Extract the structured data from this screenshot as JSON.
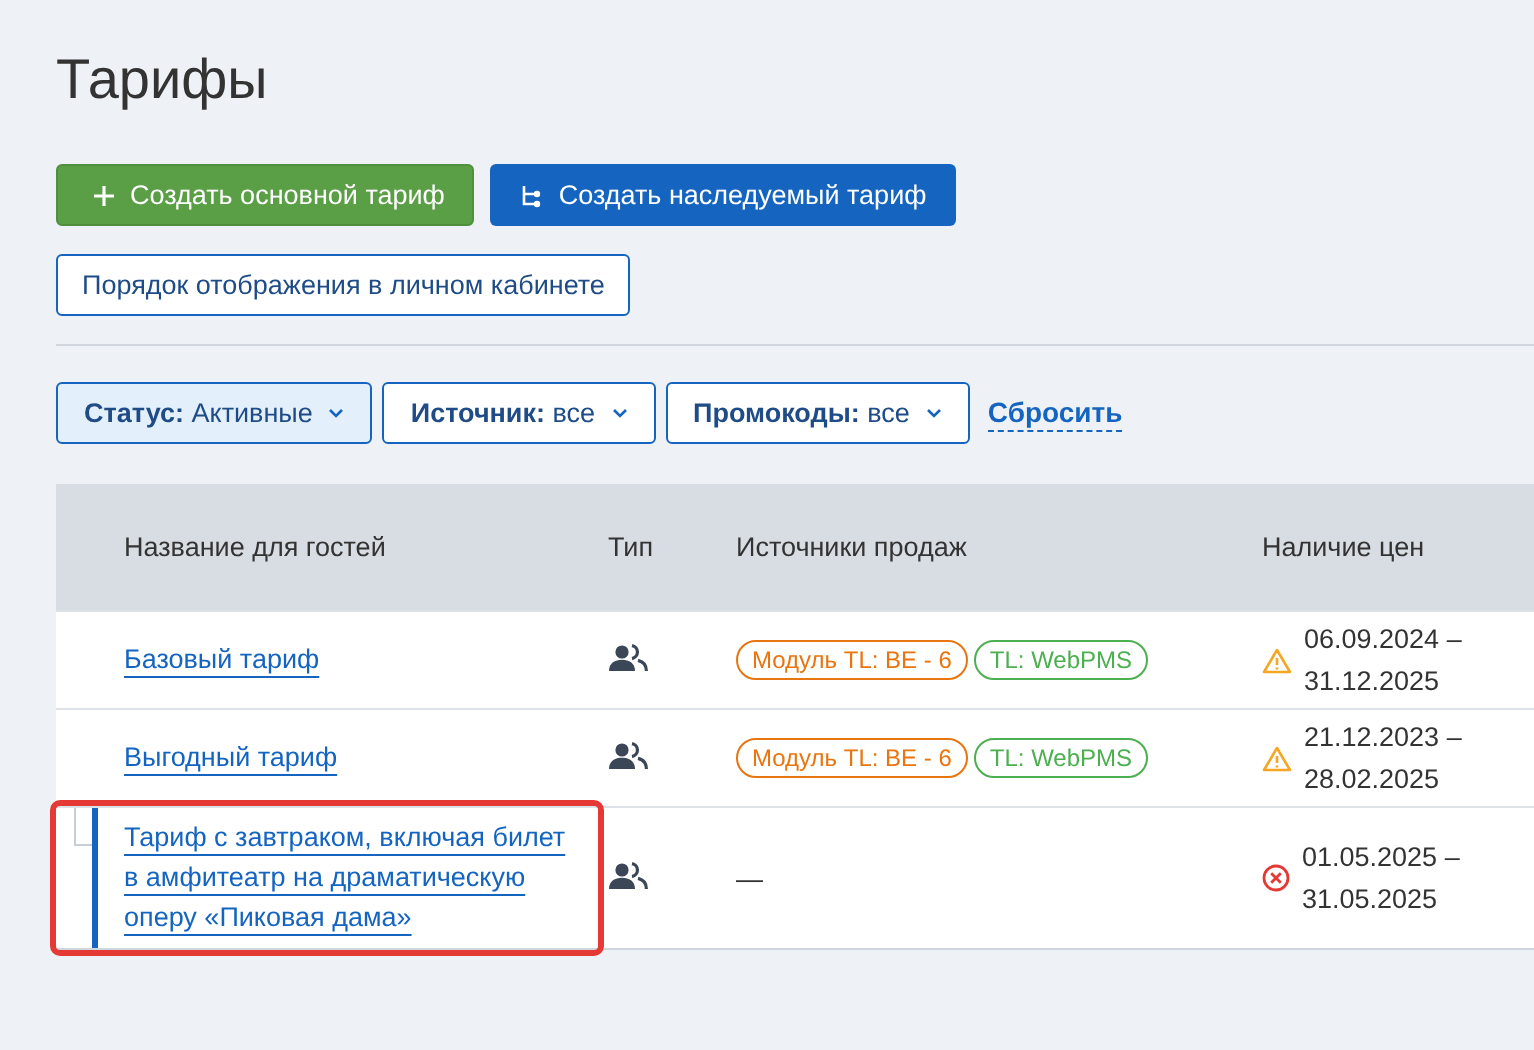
{
  "title": "Тарифы",
  "actions": [
    {
      "label": "Создать основной тариф",
      "kind": "primary"
    },
    {
      "label": "Создать наследуемый тариф",
      "kind": "secondary"
    }
  ],
  "order_button": "Порядок отображения в личном кабинете",
  "filters": [
    {
      "name": "Статус:",
      "value": "Активные",
      "selected": true
    },
    {
      "name": "Источник:",
      "value": "все",
      "selected": false
    },
    {
      "name": "Промокоды:",
      "value": "все",
      "selected": false
    }
  ],
  "reset_link": "Сбросить",
  "table": {
    "columns": [
      "Название для гостей",
      "Тип",
      "Источники продаж",
      "Наличие цен"
    ],
    "rows": [
      {
        "name": "Базовый тариф",
        "kind": "base",
        "highlighted": false,
        "sources": [
          {
            "label": "Модуль TL: BE - 6",
            "color": "#e8750f"
          },
          {
            "label": "TL: WebPMS",
            "color": "#4caf50"
          }
        ],
        "prices": {
          "kind": "warning",
          "text": "06.09.2024 –\n31.12.2025"
        }
      },
      {
        "name": "Выгодный тариф",
        "kind": "base",
        "highlighted": false,
        "sources": [
          {
            "label": "Модуль TL: BE - 6",
            "color": "#e8750f"
          },
          {
            "label": "TL: WebPMS",
            "color": "#4caf50"
          }
        ],
        "prices": {
          "kind": "warning",
          "text": "21.12.2023 –\n28.02.2025"
        }
      },
      {
        "name": "Тариф с завтраком, включая билет в амфитеатр на драматическую оперу «Пиковая дама»",
        "kind": "inherited",
        "highlighted": true,
        "sources": [],
        "no_sources": "—",
        "prices": {
          "kind": "error",
          "text": "01.05.2025 –\n31.05.2025"
        }
      }
    ]
  }
}
